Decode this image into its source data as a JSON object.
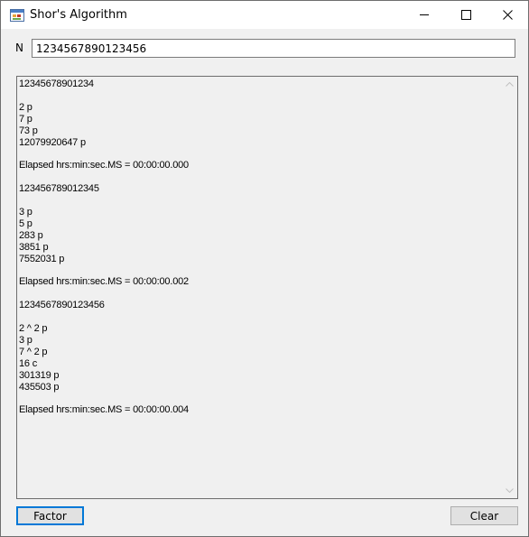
{
  "window": {
    "title": "Shor's Algorithm",
    "icon": "app-window-icon"
  },
  "input": {
    "label": "N",
    "value": "1234567890123456"
  },
  "output": {
    "text": "12345678901234\n\n2 p\n7 p\n73 p\n12079920647 p\n\nElapsed hrs:min:sec.MS = 00:00:00.000\n\n123456789012345\n\n3 p\n5 p\n283 p\n3851 p\n7552031 p\n\nElapsed hrs:min:sec.MS = 00:00:00.002\n\n1234567890123456\n\n2 ^ 2 p\n3 p\n7 ^ 2 p\n16 c\n301319 p\n435503 p\n\nElapsed hrs:min:sec.MS = 00:00:00.004"
  },
  "buttons": {
    "factor": "Factor",
    "clear": "Clear"
  },
  "colors": {
    "accent": "#0078d7",
    "background": "#f0f0f0"
  }
}
